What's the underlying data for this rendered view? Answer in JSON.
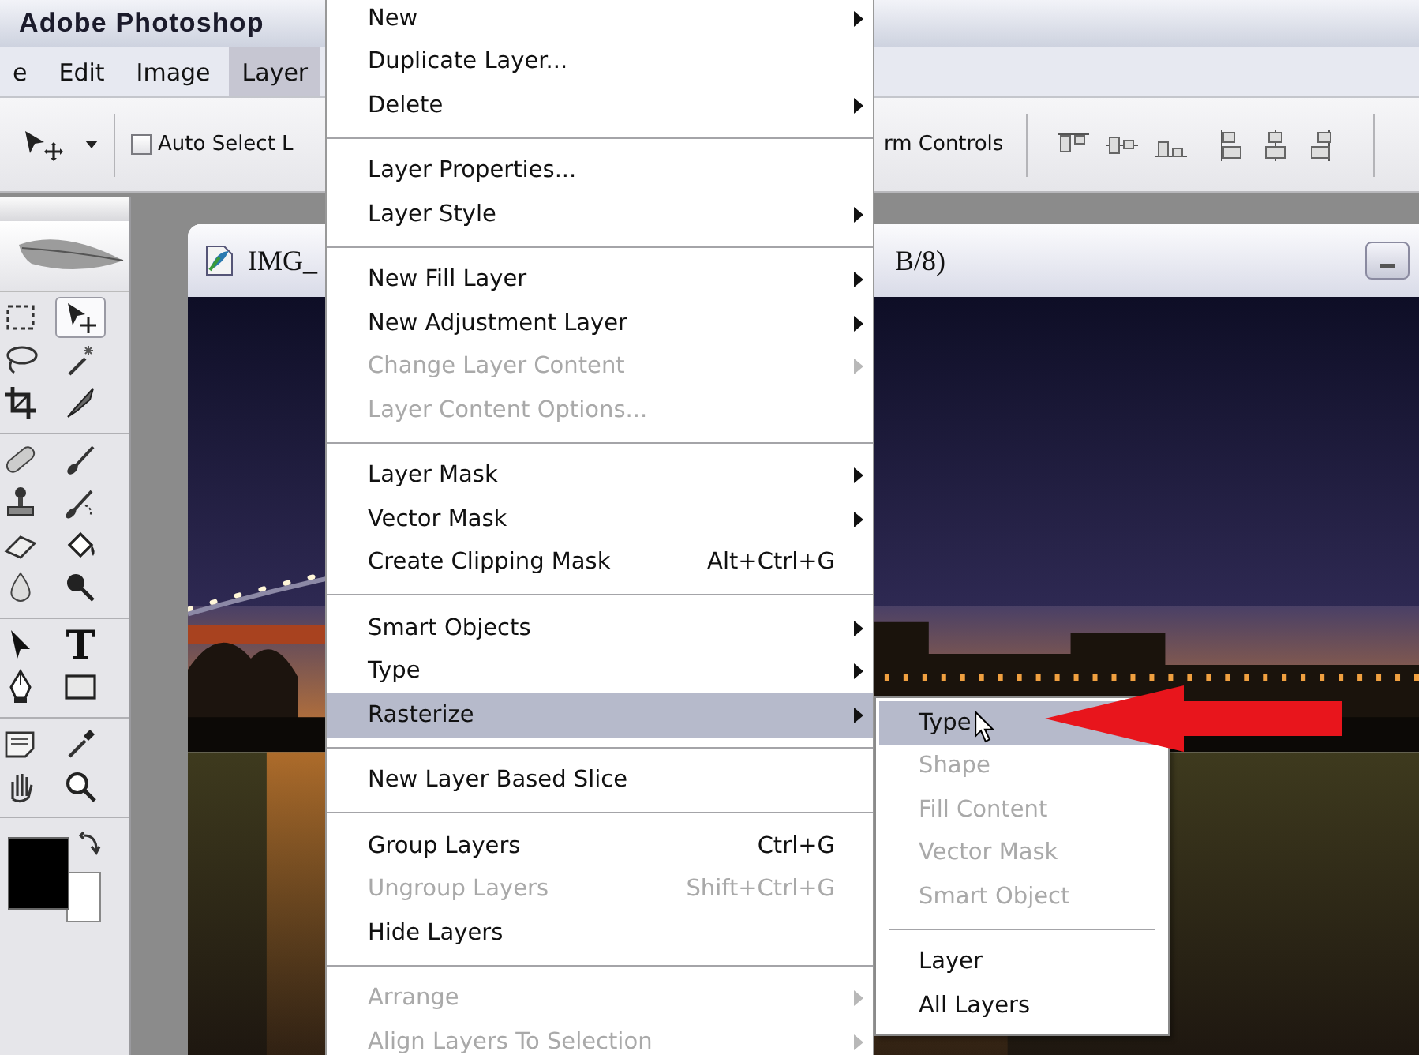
{
  "title_bar": {
    "title": "Adobe Photoshop"
  },
  "menu_bar": [
    {
      "label": "e",
      "selected": false
    },
    {
      "label": "Edit",
      "selected": false
    },
    {
      "label": "Image",
      "selected": false
    },
    {
      "label": "Layer",
      "selected": true
    }
  ],
  "options_bar": {
    "auto_select": {
      "label": "Auto Select L",
      "checked": false
    },
    "transform_controls": {
      "label": "rm Controls"
    }
  },
  "toolbox": {
    "tools": [
      {
        "selected": false
      },
      {
        "selected": true
      },
      {
        "selected": false
      },
      {
        "selected": false
      },
      {
        "selected": false
      },
      {
        "selected": false
      },
      {
        "selected": false
      },
      {
        "selected": false
      },
      {
        "selected": false
      },
      {
        "selected": false
      },
      {
        "selected": false
      },
      {
        "selected": false
      },
      {
        "selected": false
      },
      {
        "selected": false
      },
      {
        "selected": false
      },
      {
        "selected": false,
        "glyph": "T"
      },
      {
        "selected": false
      },
      {
        "selected": false
      },
      {
        "selected": false
      },
      {
        "selected": false
      },
      {
        "selected": false
      },
      {
        "selected": false
      }
    ]
  },
  "document": {
    "title_start": "IMG_",
    "title_end": "B/8)"
  },
  "layer_menu": [
    {
      "kind": "item",
      "label": "New",
      "submenu": true,
      "disabled": false,
      "selected": false
    },
    {
      "kind": "item",
      "label": "Duplicate Layer...",
      "submenu": false,
      "disabled": false,
      "selected": false
    },
    {
      "kind": "item",
      "label": "Delete",
      "submenu": true,
      "disabled": false,
      "selected": false
    },
    {
      "kind": "separator"
    },
    {
      "kind": "item",
      "label": "Layer Properties...",
      "submenu": false,
      "disabled": false,
      "selected": false
    },
    {
      "kind": "item",
      "label": "Layer Style",
      "submenu": true,
      "disabled": false,
      "selected": false
    },
    {
      "kind": "separator"
    },
    {
      "kind": "item",
      "label": "New Fill Layer",
      "submenu": true,
      "disabled": false,
      "selected": false
    },
    {
      "kind": "item",
      "label": "New Adjustment Layer",
      "submenu": true,
      "disabled": false,
      "selected": false
    },
    {
      "kind": "item",
      "label": "Change Layer Content",
      "submenu": true,
      "disabled": true,
      "selected": false
    },
    {
      "kind": "item",
      "label": "Layer Content Options...",
      "submenu": false,
      "disabled": true,
      "selected": false
    },
    {
      "kind": "separator"
    },
    {
      "kind": "item",
      "label": "Layer Mask",
      "submenu": true,
      "disabled": false,
      "selected": false
    },
    {
      "kind": "item",
      "label": "Vector Mask",
      "submenu": true,
      "disabled": false,
      "selected": false
    },
    {
      "kind": "item",
      "label": "Create Clipping Mask",
      "shortcut": "Alt+Ctrl+G",
      "submenu": false,
      "disabled": false,
      "selected": false
    },
    {
      "kind": "separator"
    },
    {
      "kind": "item",
      "label": "Smart Objects",
      "submenu": true,
      "disabled": false,
      "selected": false
    },
    {
      "kind": "item",
      "label": "Type",
      "submenu": true,
      "disabled": false,
      "selected": false
    },
    {
      "kind": "item",
      "label": "Rasterize",
      "submenu": true,
      "disabled": false,
      "selected": true
    },
    {
      "kind": "separator"
    },
    {
      "kind": "item",
      "label": "New Layer Based Slice",
      "submenu": false,
      "disabled": false,
      "selected": false
    },
    {
      "kind": "separator"
    },
    {
      "kind": "item",
      "label": "Group Layers",
      "shortcut": "Ctrl+G",
      "submenu": false,
      "disabled": false,
      "selected": false
    },
    {
      "kind": "item",
      "label": "Ungroup Layers",
      "shortcut": "Shift+Ctrl+G",
      "submenu": false,
      "disabled": true,
      "selected": false
    },
    {
      "kind": "item",
      "label": "Hide Layers",
      "submenu": false,
      "disabled": false,
      "selected": false
    },
    {
      "kind": "separator"
    },
    {
      "kind": "item",
      "label": "Arrange",
      "submenu": true,
      "disabled": true,
      "selected": false
    },
    {
      "kind": "item",
      "label": "Align Layers To Selection",
      "submenu": true,
      "disabled": true,
      "selected": false
    }
  ],
  "rasterize_submenu": [
    {
      "kind": "item",
      "label": "Type",
      "disabled": false,
      "selected": true
    },
    {
      "kind": "item",
      "label": "Shape",
      "disabled": true,
      "selected": false
    },
    {
      "kind": "item",
      "label": "Fill Content",
      "disabled": true,
      "selected": false
    },
    {
      "kind": "item",
      "label": "Vector Mask",
      "disabled": true,
      "selected": false
    },
    {
      "kind": "item",
      "label": "Smart Object",
      "disabled": true,
      "selected": false
    },
    {
      "kind": "separator"
    },
    {
      "kind": "item",
      "label": "Layer",
      "disabled": false,
      "selected": false
    },
    {
      "kind": "item",
      "label": "All Layers",
      "disabled": false,
      "selected": false
    }
  ]
}
